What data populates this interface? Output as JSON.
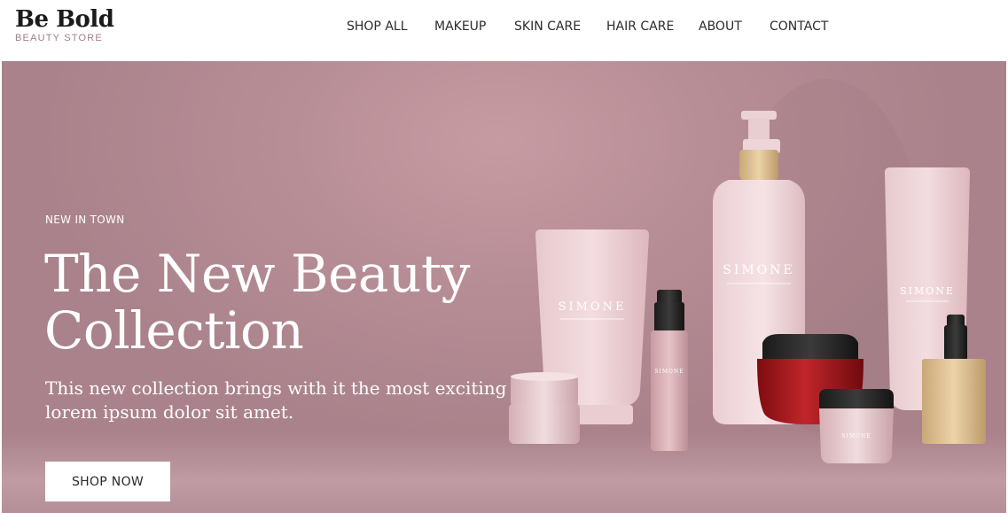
{
  "brand": {
    "title": "Be Bold",
    "subtitle": "BEAUTY STORE"
  },
  "nav": {
    "items": [
      {
        "label": "SHOP ALL"
      },
      {
        "label": "MAKEUP"
      },
      {
        "label": "SKIN CARE"
      },
      {
        "label": "HAIR CARE"
      },
      {
        "label": "ABOUT"
      },
      {
        "label": "CONTACT"
      }
    ]
  },
  "hero": {
    "eyebrow": "NEW IN TOWN",
    "headline_line1": "The New Beauty",
    "headline_line2": "Collection",
    "description_line1": "This new collection brings with it the most exciting",
    "description_line2": "lorem ipsum dolor sit amet.",
    "cta_label": "SHOP NOW",
    "product_brand": "SIMONE"
  },
  "colors": {
    "hero_background": "#b88e96",
    "text_on_hero": "#ffffff",
    "logo_subtitle": "#a07e86",
    "jar_red": "#a0161a"
  }
}
